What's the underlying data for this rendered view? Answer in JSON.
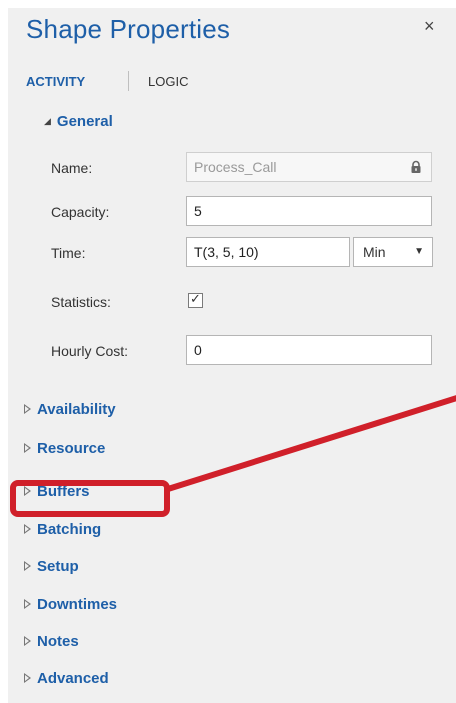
{
  "panel": {
    "title": "Shape Properties",
    "close_label": "×"
  },
  "tabs": [
    {
      "label": "ACTIVITY",
      "active": true
    },
    {
      "label": "LOGIC",
      "active": false
    }
  ],
  "general": {
    "header": "General",
    "fields": {
      "name": {
        "label": "Name:",
        "value": "Process_Call",
        "locked": true
      },
      "capacity": {
        "label": "Capacity:",
        "value": "5"
      },
      "time": {
        "label": "Time:",
        "value": "T(3, 5, 10)",
        "unit": "Min"
      },
      "statistics": {
        "label": "Statistics:",
        "checked": true,
        "check_glyph": "✓"
      },
      "hourly_cost": {
        "label": "Hourly Cost:",
        "value": "0"
      }
    }
  },
  "sections": [
    {
      "label": "Availability"
    },
    {
      "label": "Resource"
    },
    {
      "label": "Buffers",
      "highlighted": true
    },
    {
      "label": "Batching"
    },
    {
      "label": "Setup"
    },
    {
      "label": "Downtimes"
    },
    {
      "label": "Notes"
    },
    {
      "label": "Advanced"
    }
  ],
  "colors": {
    "accent": "#1e5fa8",
    "highlight": "#d0202a",
    "panel_bg": "#f0f0f0"
  },
  "icons": {
    "close": "close-icon",
    "lock": "lock-icon",
    "dropdown": "chevron-down-icon",
    "expanded": "triangle-down-icon",
    "collapsed": "triangle-right-icon"
  }
}
